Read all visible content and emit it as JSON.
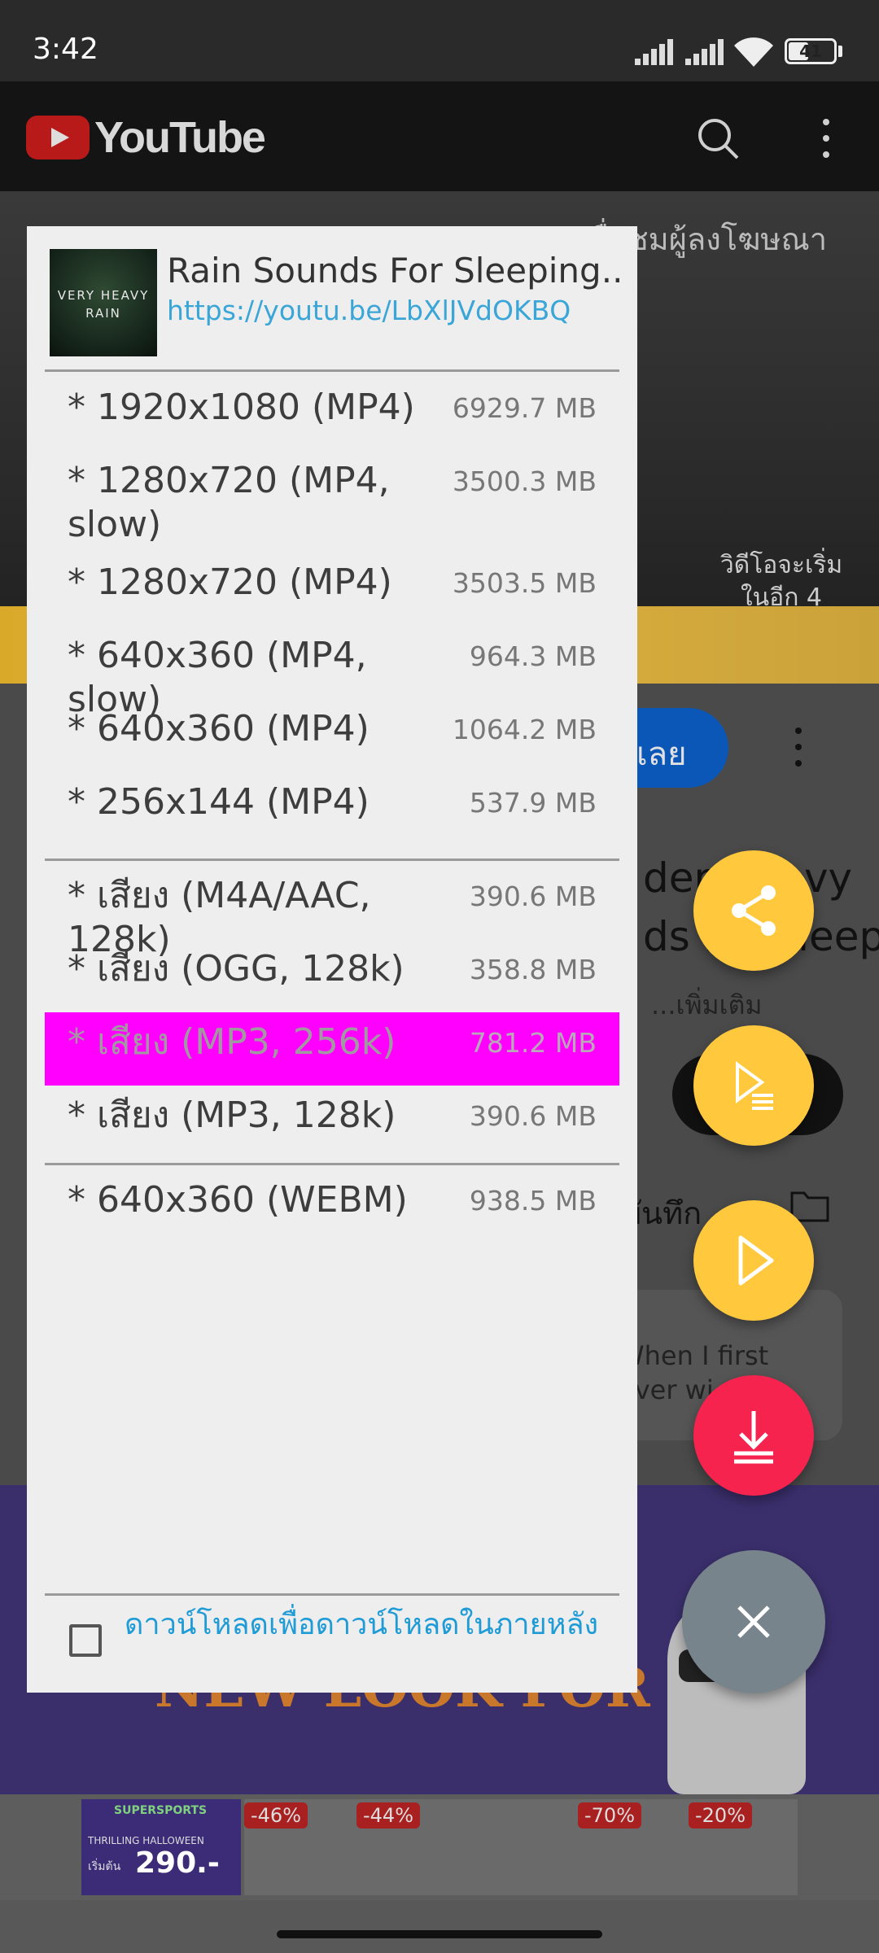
{
  "status_bar": {
    "time": "3:42",
    "battery": "41"
  },
  "background": {
    "app_name": "YouTube",
    "ad_text_right": "เพื่อชมผู้ลงโฆษณา",
    "countdown_line1": "วิดีโอจะเริ่ม",
    "countdown_line2": "ในอีก 4",
    "subscribe_partial": "เลย",
    "title_partial_1": "der  Heavy",
    "title_partial_2": "ds for Sleep",
    "more": "...เพิ่มเติม",
    "save_partial": "บันทึก",
    "comment_partial_1": "When I first",
    "comment_partial_2": "ever wi",
    "promo_text": "NEW LOOK FOR",
    "banner": {
      "brand": "SUPERSPORTS",
      "event": "THRILLING HALLOWEEN",
      "price_label": "เริ่มต้น",
      "price": "290.-",
      "discounts": [
        "-46%",
        "-44%",
        "-70%",
        "-20%"
      ]
    }
  },
  "dialog": {
    "thumbnail_text": "VERY HEAVY RAIN",
    "title": "Rain Sounds For Sleeping..",
    "url": "https://youtu.be/LbXlJVdOKBQ",
    "video_formats": [
      {
        "label": "* 1920x1080 (MP4)",
        "size": "6929.7 MB"
      },
      {
        "label": "* 1280x720 (MP4, slow)",
        "size": "3500.3 MB"
      },
      {
        "label": "* 1280x720 (MP4)",
        "size": "3503.5 MB"
      },
      {
        "label": "* 640x360 (MP4, slow)",
        "size": "964.3 MB"
      },
      {
        "label": "* 640x360 (MP4)",
        "size": "1064.2 MB"
      },
      {
        "label": "* 256x144 (MP4)",
        "size": "537.9 MB"
      }
    ],
    "audio_formats": [
      {
        "label": "* เสียง (M4A/AAC, 128k)",
        "size": "390.6 MB"
      },
      {
        "label": "* เสียง (OGG, 128k)",
        "size": "358.8 MB"
      },
      {
        "label": "* เสียง (MP3, 256k)",
        "size": "781.2 MB",
        "selected": true
      },
      {
        "label": "* เสียง (MP3, 128k)",
        "size": "390.6 MB"
      }
    ],
    "other_formats": [
      {
        "label": "* 640x360 (WEBM)",
        "size": "938.5 MB"
      }
    ],
    "background_download_label": "ดาวน์โหลดเพื่อดาวน์โหลดในภายหลัง",
    "selected_color": "#ff00ff"
  },
  "fabs": {
    "share_icon": "share-icon",
    "queue_icon": "playlist-play-icon",
    "play_icon": "play-icon",
    "download_icon": "download-icon",
    "close_icon": "close-icon",
    "accent_yellow": "#ffc83d",
    "accent_red": "#f5234e",
    "close_gray": "#78848c"
  }
}
